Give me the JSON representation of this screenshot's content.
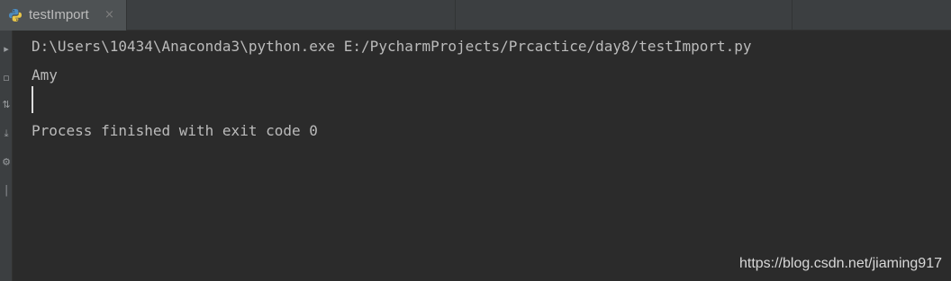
{
  "tab": {
    "title": "testImport",
    "close_glyph": "×",
    "icon": "python-file-icon"
  },
  "gutter_icons": [
    "rerun-icon",
    "stop-icon",
    "scroll-to-end-icon",
    "print-icon",
    "settings-icon",
    "close-icon"
  ],
  "console": {
    "command_line": "D:\\Users\\10434\\Anaconda3\\python.exe E:/PycharmProjects/Prcactice/day8/testImport.py",
    "output_line": "Amy",
    "status_line": "Process finished with exit code 0"
  },
  "watermark": "https://blog.csdn.net/jiaming917",
  "colors": {
    "background": "#2b2b2b",
    "tabbar": "#3c3f41",
    "active_tab": "#4e5254",
    "text": "#bbbbbb"
  }
}
